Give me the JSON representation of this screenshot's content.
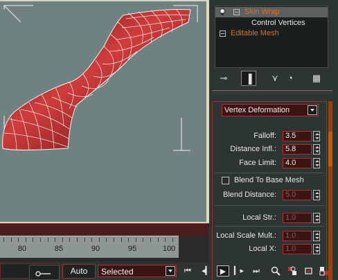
{
  "viewport": {
    "name": "perspective-viewport"
  },
  "timeline": {
    "ticks": [
      "80",
      "85",
      "90",
      "95",
      "100"
    ]
  },
  "modifier_stack": {
    "items": [
      {
        "label": "Skin Wrap",
        "selected": true
      },
      {
        "label": "Control Vertices",
        "selected": false
      },
      {
        "label": "Editable Mesh",
        "selected": false
      }
    ]
  },
  "rollout": {
    "mode_dropdown": "Vertex Deformation",
    "params": {
      "falloff_label": "Falloff:",
      "falloff_value": "3.5",
      "distance_infl_label": "Distance Infl.:",
      "distance_infl_value": "5.8",
      "face_limit_label": "Face Limit:",
      "face_limit_value": "4.0",
      "blend_label": "Blend To Base Mesh",
      "blend_distance_label": "Blend Distance:",
      "blend_distance_value": "5.0",
      "local_str_label": "Local Str.:",
      "local_str_value": "1.0",
      "local_scale_label": "Local Scale Mult.:",
      "local_scale_value": "1.0",
      "local_x_label": "Local X:",
      "local_x_value": "1.0"
    }
  },
  "bottom": {
    "autokey_label": "Auto Key",
    "selection_dropdown": "Selected"
  },
  "colors": {
    "viewport_bg": "#6f8181",
    "accent_orange": "#e07020",
    "field_border": "#b03030",
    "mesh_red": "#b02828"
  }
}
